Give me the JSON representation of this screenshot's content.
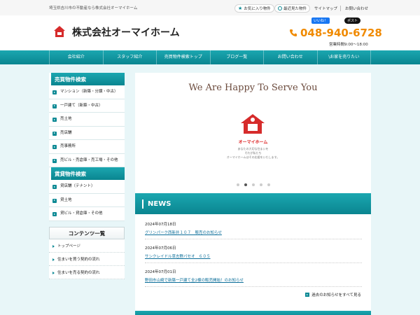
{
  "topbar": {
    "tagline": "埼玉県吉川市の不動産なら株式会社オーマイホーム",
    "favorites_label": "お気に入り物件",
    "recent_label": "最近見た物件",
    "sitemap_label": "サイトマップ",
    "contact_label": "お問い合わせ"
  },
  "header": {
    "site_title": "株式会社オーマイホーム",
    "phone": "048-940-6728",
    "hours": "営業時間9:00～18:00",
    "like_label": "いいね！",
    "post_label": "ポスト"
  },
  "nav": {
    "items": [
      {
        "label": "会社紹介"
      },
      {
        "label": "スタッフ紹介"
      },
      {
        "label": "売買物件検索トップ"
      },
      {
        "label": "ブログ一覧"
      },
      {
        "label": "お問い合わせ"
      },
      {
        "label": "\\お家を売りたい"
      }
    ]
  },
  "sidebar": {
    "sale_title": "売買物件検索",
    "sale_items": [
      {
        "label": "マンション（新築・分譲・中古）"
      },
      {
        "label": "一戸建て（新築・中古）"
      },
      {
        "label": "売土地"
      },
      {
        "label": "売店舗"
      },
      {
        "label": "売事務所"
      },
      {
        "label": "売ビル・売倉庫・売工場・その他"
      }
    ],
    "rent_title": "賃貸物件検索",
    "rent_items": [
      {
        "label": "貸店舗（テナント）"
      },
      {
        "label": "貸土地"
      },
      {
        "label": "貸ビル・貸倉庫・その他"
      }
    ],
    "contents_title": "コンテンツ一覧",
    "contents_items": [
      {
        "label": "トップページ"
      },
      {
        "label": "住まいを買う契約の流れ"
      },
      {
        "label": "住まいを売る契約の流れ"
      }
    ]
  },
  "hero": {
    "title": "We Are Happy To Serve You",
    "brand": "オーマイホーム",
    "copy": "あなたの大切な住まいを\nそれが私たち\nオーマイホームはその応援をいたします。",
    "slide_count": 5,
    "active_slide": 2
  },
  "news": {
    "title": "NEWS",
    "items": [
      {
        "date": "2024年07月18日",
        "title": "グリンパーク西新井１０７　販売のお知らせ"
      },
      {
        "date": "2024年07月06日",
        "title": "サンクレイドル草志野パセオ　６０５"
      },
      {
        "date": "2024年07月01日",
        "title": "野田市山崎で新築一戸建て全2棟の販売開始！のお知らせ"
      }
    ],
    "more_label": "過去のお知らせをすべて見る"
  },
  "colors": {
    "accent": "#0e8a95",
    "phone": "#f08a00",
    "background": "#e8f6f8"
  }
}
